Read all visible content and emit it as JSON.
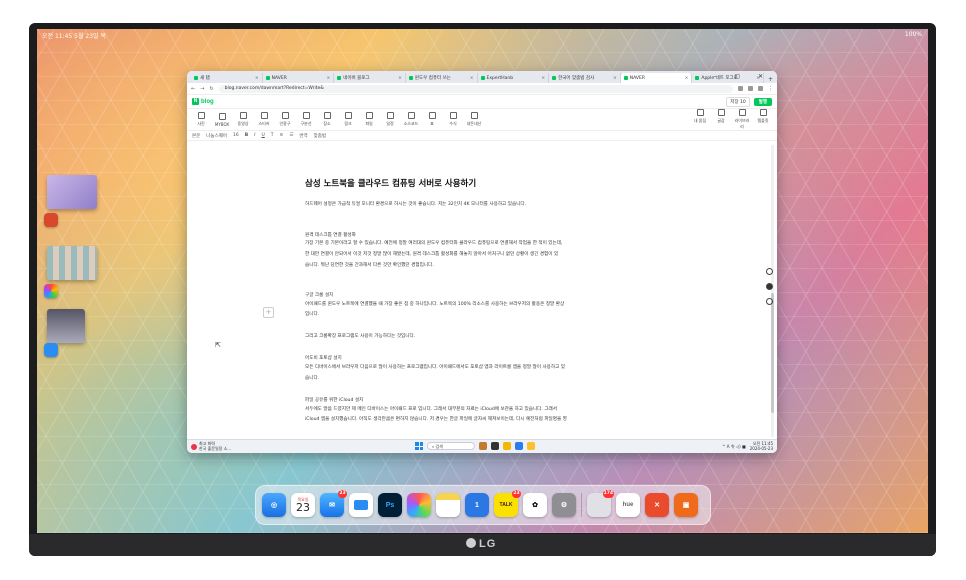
{
  "monitor": {
    "brand": "LG"
  },
  "ipad": {
    "status_left": "오전 11:45 5월 23일 목",
    "status_right": "100%"
  },
  "browser": {
    "tabs": [
      {
        "label": "새 탭",
        "active": false
      },
      {
        "label": "NAVER",
        "active": false
      },
      {
        "label": "네이버 블로그",
        "active": false
      },
      {
        "label": "윈도우 컴퓨터 쓰는",
        "active": false
      },
      {
        "label": "ExpertHanb",
        "active": false
      },
      {
        "label": "한국어 맞춤법 검사",
        "active": false
      },
      {
        "label": "NAVER",
        "active": true
      },
      {
        "label": "Apple 네트 포그로",
        "active": false
      }
    ],
    "new_tab": "+",
    "window_controls": "– ▢ ✕",
    "url": "blog.naver.com/dawnmart?Redirect=Write&"
  },
  "blog": {
    "logo_n": "N",
    "logo_text": "blog",
    "save_label": "저장",
    "save_count": "10",
    "publish_label": "발행"
  },
  "toolbar": {
    "items": [
      "사진",
      "MYBOX",
      "동영상",
      "스티커",
      "인용구",
      "구분선",
      "장소",
      "링크",
      "파일",
      "일정",
      "소스코드",
      "표",
      "수식",
      "내돈내산"
    ],
    "right_items": [
      "내 몸짐",
      "글감",
      "라이브러리",
      "템플릿"
    ]
  },
  "format_bar": {
    "style": "본문",
    "font": "나눔스퀘어",
    "size": "16",
    "spellcheck": "맞춤법",
    "translate": "번역"
  },
  "document": {
    "title": "삼성 노트북을 클라우드 컴퓨팅 서버로 사용하기",
    "paragraphs": [
      "하드웨어 설정은 가급적 듀얼 모니터 환경으로 하시는 것이 좋습니다. 저는 32인치 4K 모니터를 사용하고 있습니다.",
      "원격 데스크톱 연결 활성화",
      "가장 기본 중 기본이라고 할 수 있습니다. 예전에 정말 여러대의 윈도우 컴퓨터와 클라우드 컴퓨팅으로 연결해서 작업을 한 적이 있는데,",
      "한 대만 연결이 안되어서 이것 저것 정말 많이 해봤는데, 원격 데스크톱 활성화를 해놓지 않아서 어처구니 없던 상황이 생긴 경험이 있",
      "습니다. 뭐난 당연한 것을 간과해서 다른 것만 확인했던 경험입니다.",
      "구글 크롬 설치",
      "아이패드를 윈도우 노트북에 연결했을 때 가장 좋은 점 중 하나입니다. 노트북의 100% 리소스를 사용하는 브라우저의 활용은 정말 환상",
      "입니다.",
      "그리고 크롬확장 프로그램도 사용이 가능하다는 것입니다.",
      "어도비 포토샵 설치",
      "모든 디바이스에서 브라우저 다음으로 많이 사용하는 프로그램입니다. 아이패드에서도 포토샵 앱과 라이트룸 앱을 정말 많이 사용하고 있",
      "습니다.",
      "파일 공유를 위한 iCloud 설치",
      "서두에도 말씀 드렸지만 제 메인 디바이스는 아이패드 프로 입니다. 그래서 대부분의 자료는 iCloud에 보관을 하고 있습니다. 그래서",
      "iCloud 앱을 설치했습니다. 아직도 생각만큼은 편하지 않습니다. 저 경우는 한글 파일에 글자씨 깨져보이는데, 다시 예전처럼 파일명을 영"
    ],
    "add_block": "+",
    "help": "?"
  },
  "taskbar": {
    "weather_title": "최고 화력",
    "weather_sub": "한국 출문일정 소...",
    "search_label": "검색",
    "tray": "^ A 令 ◁) ■",
    "time": "오전 11:45",
    "date": "2024-05-23"
  },
  "dock": {
    "calendar_weekday": "목요일",
    "calendar_day": "23",
    "mail_badge": "23",
    "kakao_badge": "23",
    "appstore_badge": "174",
    "ps_label": "Ps",
    "kakao_label": "TALK",
    "hue_label": "hue",
    "apps": [
      "safari",
      "calendar",
      "mail",
      "files",
      "photoshop",
      "photos",
      "notes",
      "translator",
      "kakaotalk",
      "chatgpt",
      "settings",
      "app-folder",
      "hue",
      "remote",
      "shopping"
    ]
  },
  "colors": {
    "naver_green": "#03c75a",
    "windows_blue": "#1e88e5"
  }
}
